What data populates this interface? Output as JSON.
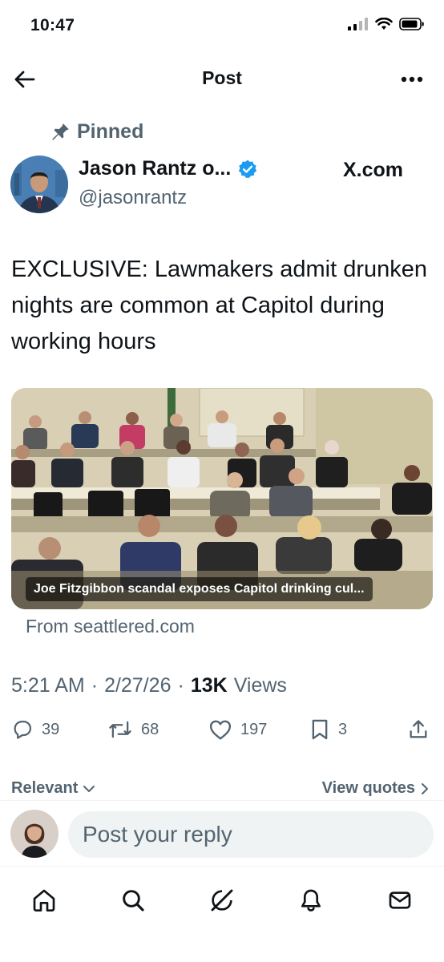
{
  "status_bar": {
    "time": "10:47"
  },
  "header": {
    "title": "Post"
  },
  "pinned": {
    "label": "Pinned"
  },
  "author": {
    "name": "Jason Rantz o...",
    "handle": "@jasonrantz",
    "verified": true,
    "site": "X.com"
  },
  "tweet": {
    "text": "EXCLUSIVE: Lawmakers admit drunken nights are common at Capitol during working hours"
  },
  "media": {
    "caption": "Joe Fitzgibbon scandal exposes Capitol drinking cul...",
    "source": "From seattlered.com"
  },
  "meta": {
    "time": "5:21 AM",
    "separator": "·",
    "date": "2/27/26",
    "views_count": "13K",
    "views_label": "Views"
  },
  "actions": {
    "replies": "39",
    "reposts": "68",
    "likes": "197",
    "bookmarks": "3"
  },
  "filters": {
    "relevant": "Relevant",
    "view_quotes": "View quotes"
  },
  "reply": {
    "placeholder": "Post your reply"
  },
  "colors": {
    "verified": "#1d9bf0",
    "secondary_text": "#536471",
    "primary_text": "#0f1419",
    "input_bg": "#eff3f4"
  },
  "icons": {
    "back": "arrow-left-icon",
    "more": "more-icon",
    "pin": "pin-icon",
    "verified": "verified-badge-icon",
    "reply": "reply-icon",
    "repost": "repost-icon",
    "like": "heart-icon",
    "bookmark": "bookmark-icon",
    "share": "share-icon",
    "nav": [
      "home-icon",
      "search-icon",
      "grok-icon",
      "notifications-icon",
      "messages-icon"
    ]
  }
}
